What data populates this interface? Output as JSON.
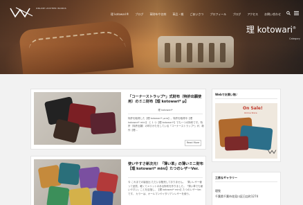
{
  "header": {
    "logo_text": "ONLINE LEATHER WORKS",
    "nav": [
      "理 kotowari®",
      "ブログ",
      "革財布や名刺",
      "革品・雑",
      "ごあいさつ",
      "プロフィール",
      "ブログ",
      "アクセス",
      "お問い合わせ"
    ],
    "brand": "理 kotowari",
    "brand_mark": "®",
    "category": "Category"
  },
  "posts": [
    {
      "title": "「コーナーストラップ*」式財布（特許出願使用）のミニ財布【理 kotowari* μ】",
      "category": "理 kotowari*",
      "excerpt": "特許を取得した【理 kotowari*  μcro】。特許を取得中【理 kotowari* mini】 と 1 つ【理 kotowari*】でも一つの財布です。特許（特許出願）の呼びかたをしている「コーナーストラップ*」が、新作【理...",
      "readmore": "Read More"
    },
    {
      "title": "使いやすさ新次元！「薄い革」の薄いミニ財布【理 kotowari* mini】たつのレザーVer.",
      "category": "",
      "excerpt": "今 これまでの製品比 ただいま販売しておりません。　薄いレザー使って品質、軽くてメリットのある財布を作りました。「薄い革でも使いやすい」ことを目指し、【理 kotowari* mini】たつのレザーVer.です。 カラーは、オールマンやイタリアンレザーを使う。"
    }
  ],
  "sidebar": {
    "widget1_title": "Webでお買い物♪",
    "ad_title": "On Sale!",
    "ad_sub": "Online Store",
    "widget2_title": "工房＆ギャラリー",
    "address_name": "理牧",
    "address": "千葉県千葉市花見川区日吉町1274"
  },
  "colors": {
    "accent": "#c0392b",
    "background": "#f2f2f2"
  }
}
